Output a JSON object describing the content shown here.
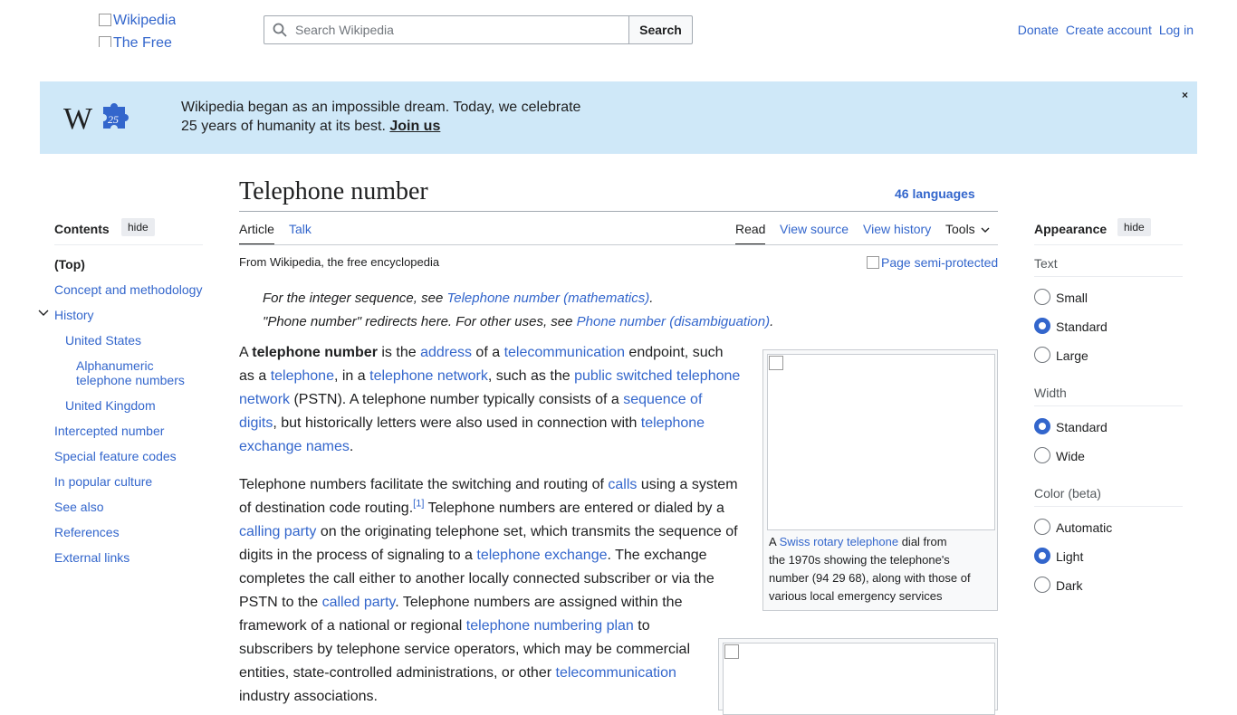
{
  "header": {
    "logo_alt": "Wikipedia",
    "tagline_alt": "The Free",
    "search_placeholder": "Search Wikipedia",
    "search_button": "Search",
    "user_links": [
      "Donate",
      "Create account",
      "Log in"
    ]
  },
  "banner": {
    "line1": "Wikipedia began as an impossible dream. Today, we celebrate",
    "line2": "25 years of humanity at its best. ",
    "join_label": "Join us",
    "close_label": "×",
    "logo_letter": "W",
    "logo_badge": "25",
    "colors": {
      "background": "#cfe8f8",
      "puzzle": "#3366cc"
    }
  },
  "page": {
    "title": "Telephone number",
    "languages": "46 languages",
    "tabs_left": [
      "Article",
      "Talk"
    ],
    "tabs_right": [
      "Read",
      "View source",
      "View history",
      "Tools"
    ],
    "tagline": "From Wikipedia, the free encyclopedia",
    "semi_protected_alt": "Page semi-protected"
  },
  "hatnotes": {
    "h1_pre": "For the integer sequence, see ",
    "h1_link": "Telephone number (mathematics)",
    "h1_post": ".",
    "h2_pre": "\"Phone number\" redirects here. For other uses, see ",
    "h2_link": "Phone number (disambiguation)",
    "h2_post": "."
  },
  "para1": {
    "t1": "A ",
    "bold": "telephone number",
    "t2": " is the ",
    "l1": "address",
    "t3": " of a ",
    "l2": "telecommunication",
    "t4": " endpoint, such",
    "t5": "as a ",
    "l3": "telephone",
    "t6": ", in a ",
    "l4": "telephone network",
    "t7": ", such as the ",
    "l5": "public switched telephone",
    "l5b": "network",
    "t8": " (PSTN). A telephone number typically consists of a ",
    "l6": "sequence of",
    "l6b": "digits",
    "t9": ", but historically letters were also used in connection with ",
    "l7": "telephone",
    "l7b": "exchange names",
    "t10": "."
  },
  "para2": {
    "t1": "Telephone numbers facilitate the switching and routing of ",
    "l1": "calls",
    "t2": " using a system",
    "t3": "of destination code routing.",
    "ref": "[1]",
    "t4": " Telephone numbers are entered or dialed by a",
    "l2": "calling party",
    "t5": " on the originating telephone set, which transmits the sequence of",
    "t6": "digits in the process of signaling to a ",
    "l3": "telephone exchange",
    "t7": ". The exchange",
    "t8": "completes the call either to another locally connected subscriber or via the",
    "t9": "PSTN to the ",
    "l4": "called party",
    "t10": ". Telephone numbers are assigned within the",
    "t11": "framework of a national or regional ",
    "l5": "telephone numbering plan",
    "t12": " to",
    "t13": "subscribers by telephone service operators, which may be commercial",
    "t14": "entities, state-controlled administrations, or other ",
    "l6": "telecommunication",
    "t15": "industry associations."
  },
  "figure1": {
    "cap_pre": "A ",
    "cap_link": "Swiss rotary telephone",
    "cap_l1": " dial from",
    "cap_l2": "the 1970s showing the telephone's",
    "cap_l3": "number (94 29 68), along with those of",
    "cap_l4": "various local emergency services"
  },
  "toc": {
    "title": "Contents",
    "hide": "hide",
    "items": [
      "(Top)",
      "Concept and methodology",
      "History",
      "United States",
      "Alphanumeric",
      "telephone numbers",
      "United Kingdom",
      "Intercepted number",
      "Special feature codes",
      "In popular culture",
      "See also",
      "References",
      "External links"
    ]
  },
  "appearance": {
    "title": "Appearance",
    "hide": "hide",
    "text_label": "Text",
    "text_options": [
      "Small",
      "Standard",
      "Large"
    ],
    "text_selected": "Standard",
    "width_label": "Width",
    "width_options": [
      "Standard",
      "Wide"
    ],
    "width_selected": "Standard",
    "color_label": "Color (beta)",
    "color_options": [
      "Automatic",
      "Light",
      "Dark"
    ],
    "color_selected": "Light"
  }
}
